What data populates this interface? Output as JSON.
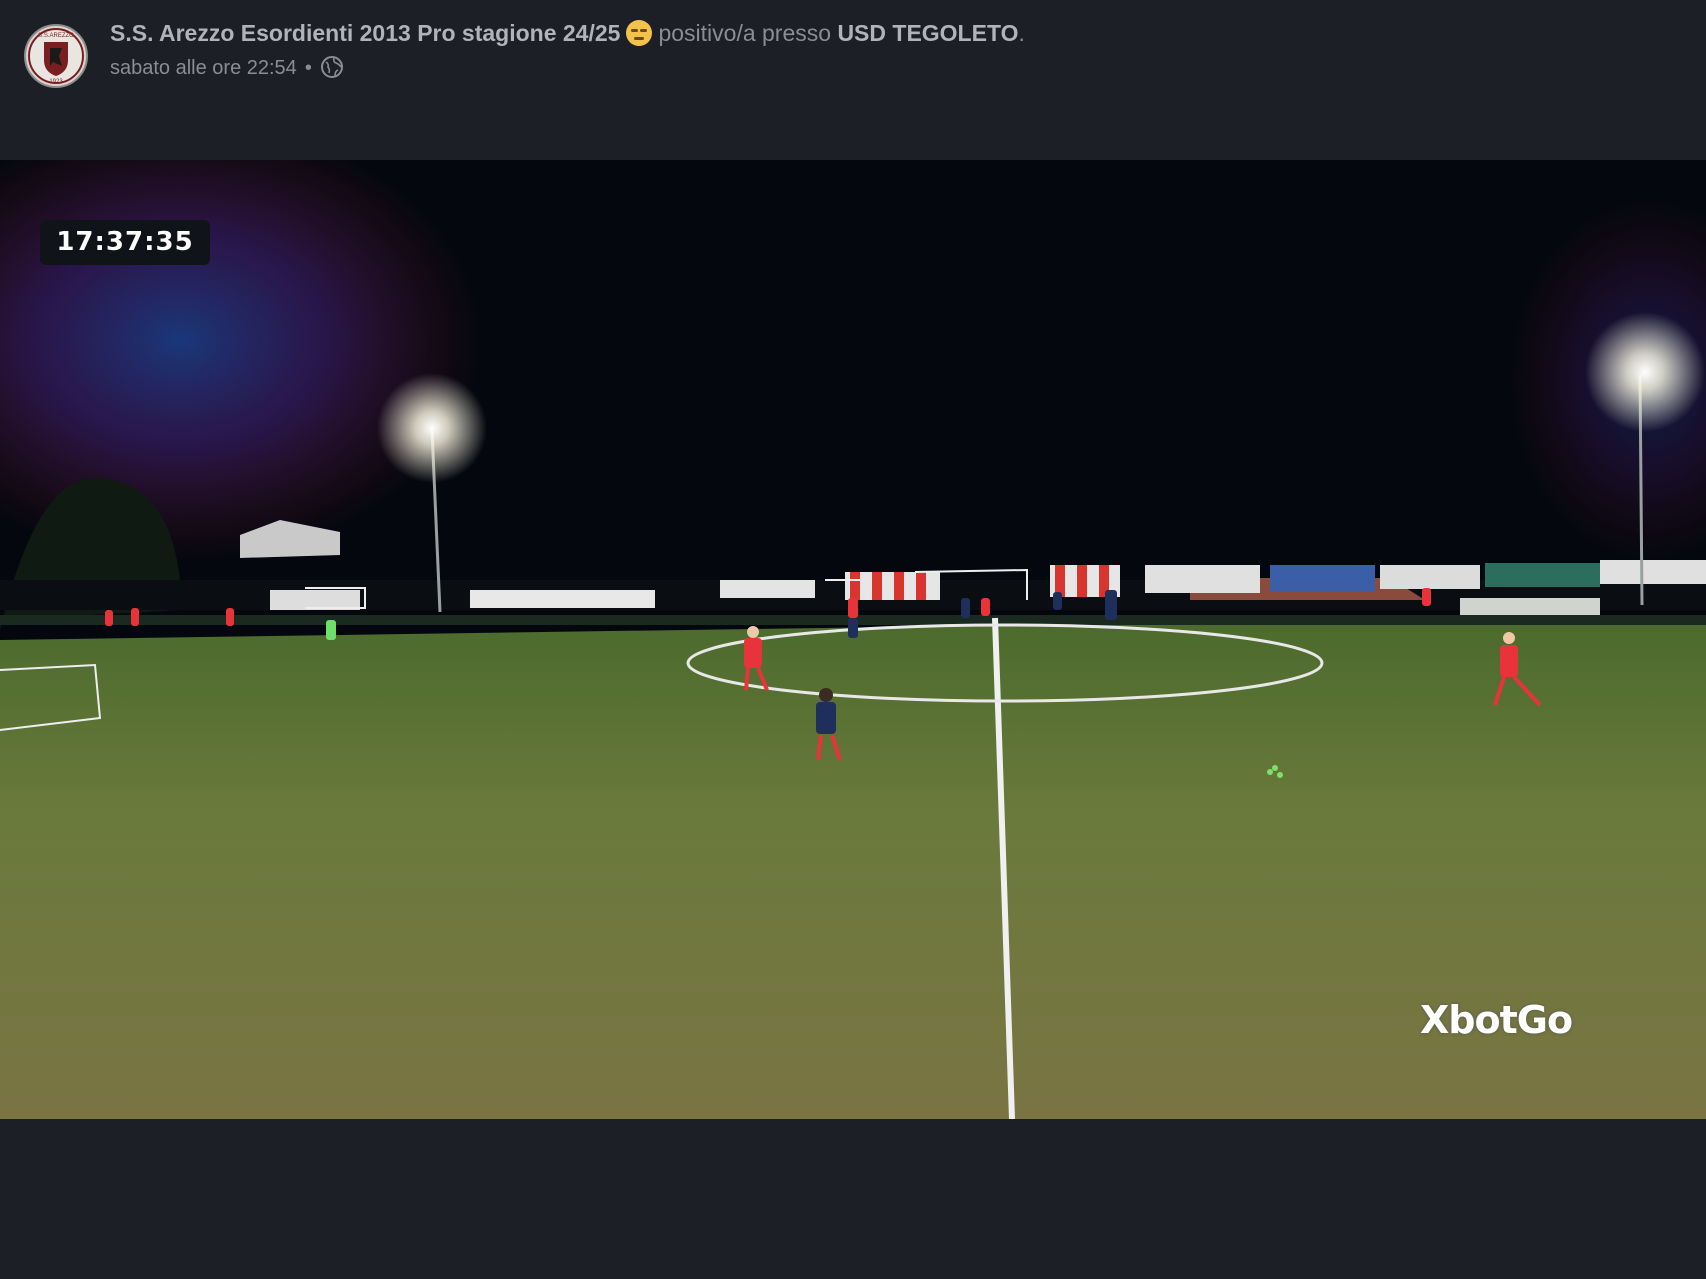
{
  "post": {
    "author": "S.S. Arezzo Esordienti 2013 Pro stagione 24/25",
    "feeling_emoji": "relieved-face",
    "action_text": "positivo/a presso",
    "location": "USD TEGOLETO",
    "period": ".",
    "timestamp": "sabato alle ore 22:54",
    "separator": "•",
    "privacy_icon": "globe-icon"
  },
  "avatar": {
    "logo_text_top": "S.S.AREZZO",
    "logo_year": "1923"
  },
  "video": {
    "clock": "17:37:35",
    "watermark": "XbotGo"
  }
}
